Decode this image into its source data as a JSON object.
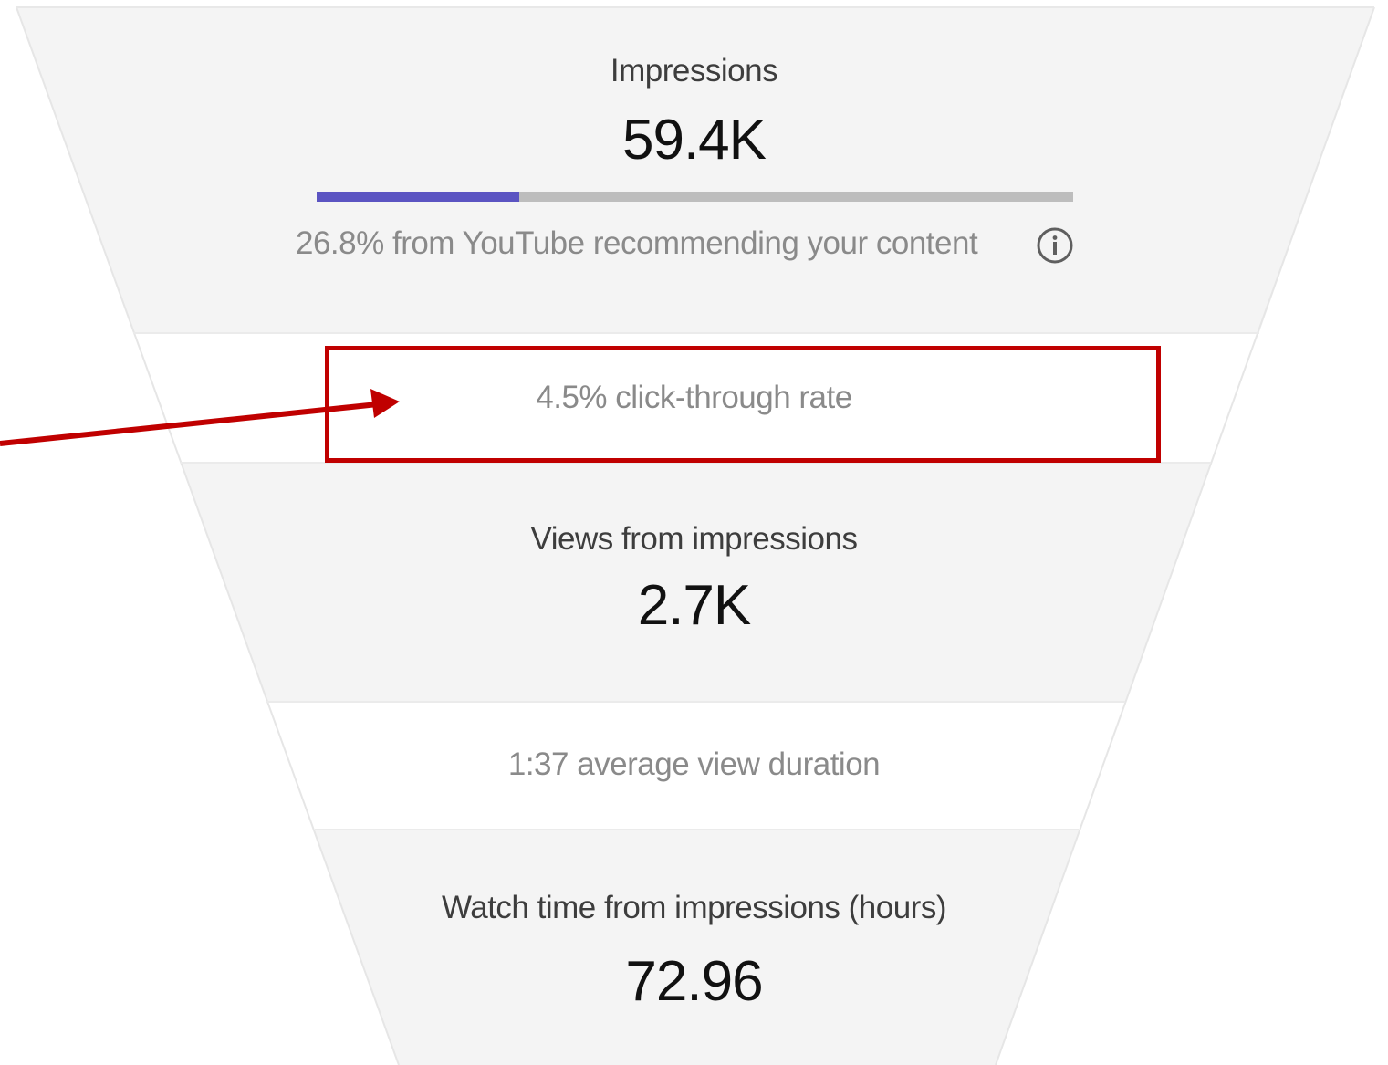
{
  "funnel": {
    "impressions": {
      "label": "Impressions",
      "value": "59.4K",
      "recommendation_share": 0.268,
      "recommendation_text": "26.8% from YouTube recommending your content"
    },
    "ctr_text": "4.5% click-through rate",
    "views": {
      "label": "Views from impressions",
      "value": "2.7K"
    },
    "avg_duration_text": "1:37 average view duration",
    "watch_time": {
      "label": "Watch time from impressions (hours)",
      "value": "72.96"
    }
  },
  "colors": {
    "band_fill": "#f4f4f4",
    "progress_fill": "#5b54c2",
    "progress_track": "#bdbdbd",
    "annotation": "#c00000"
  },
  "icons": {
    "info": "info-icon"
  }
}
